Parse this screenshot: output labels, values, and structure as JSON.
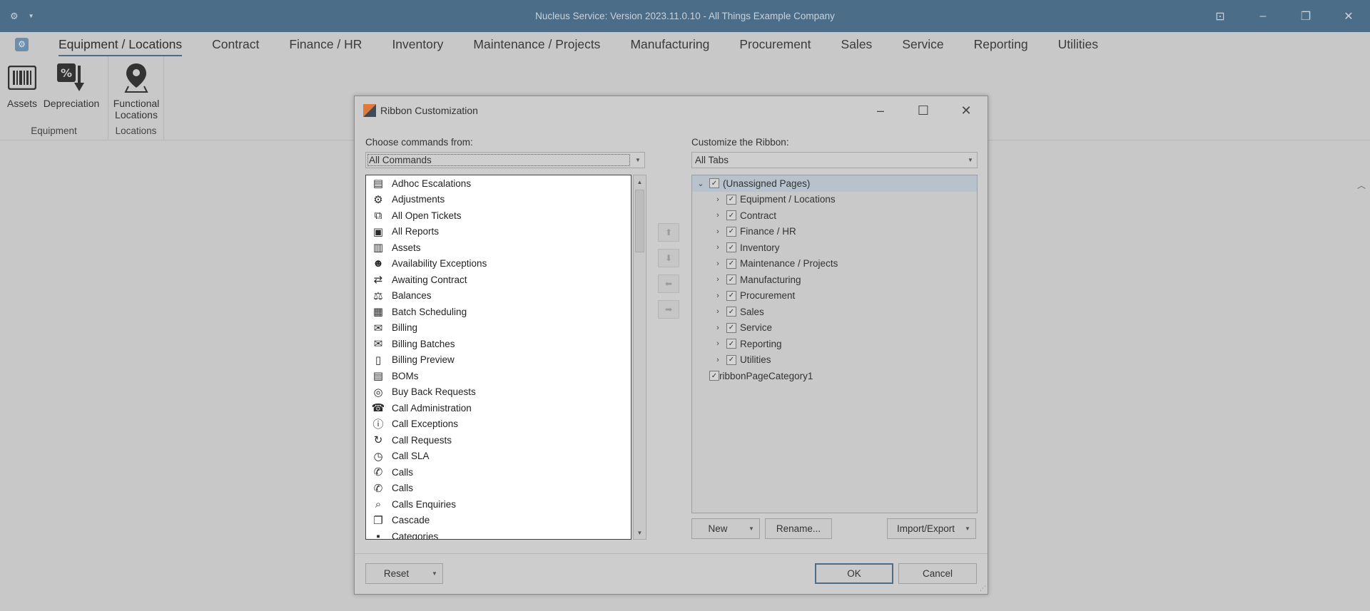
{
  "window": {
    "title": "Nucleus Service: Version 2023.11.0.10 - All Things Example Company",
    "settings_icon": "gear-icon"
  },
  "menu": {
    "tabs": [
      "Equipment / Locations",
      "Contract",
      "Finance / HR",
      "Inventory",
      "Maintenance / Projects",
      "Manufacturing",
      "Procurement",
      "Sales",
      "Service",
      "Reporting",
      "Utilities"
    ],
    "active_tab": "Equipment / Locations"
  },
  "ribbon": {
    "groups": [
      {
        "label": "Equipment",
        "buttons": [
          {
            "label": "Assets",
            "icon": "barcode-icon"
          },
          {
            "label": "Depreciation",
            "icon": "percent-down-icon"
          }
        ]
      },
      {
        "label": "Locations",
        "buttons": [
          {
            "label": "Functional\nLocations",
            "icon": "location-pin-icon"
          }
        ]
      }
    ]
  },
  "dialog": {
    "title": "Ribbon Customization",
    "choose_label": "Choose commands from:",
    "choose_value": "All Commands",
    "customize_label": "Customize the Ribbon:",
    "customize_value": "All Tabs",
    "commands": [
      "Adhoc Escalations",
      "Adjustments",
      "All Open Tickets",
      "All Reports",
      "Assets",
      "Availability Exceptions",
      "Awaiting Contract",
      "Balances",
      "Batch Scheduling",
      "Billing",
      "Billing Batches",
      "Billing Preview",
      "BOMs",
      "Buy Back Requests",
      "Call Administration",
      "Call Exceptions",
      "Call Requests",
      "Call SLA",
      "Calls",
      "Calls",
      "Calls Enquiries",
      "Cascade",
      "Categories"
    ],
    "tree": {
      "root": "(Unassigned Pages)",
      "children": [
        "Equipment / Locations",
        "Contract",
        "Finance / HR",
        "Inventory",
        "Maintenance / Projects",
        "Manufacturing",
        "Procurement",
        "Sales",
        "Service",
        "Reporting",
        "Utilities"
      ],
      "extra": "ribbonPageCategory1"
    },
    "buttons": {
      "new": "New",
      "rename": "Rename...",
      "import_export": "Import/Export",
      "reset": "Reset",
      "ok": "OK",
      "cancel": "Cancel"
    }
  }
}
